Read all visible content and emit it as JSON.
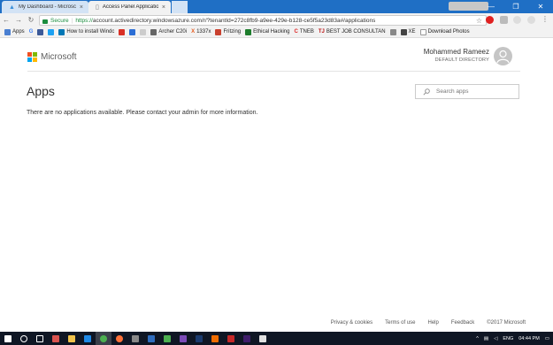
{
  "browser": {
    "tabs": [
      {
        "title": "My Dashboard - Microsc",
        "active": false
      },
      {
        "title": "Access Panel Applicatio",
        "active": true
      }
    ],
    "secure_label": "Secure",
    "url_proto": "https://",
    "url_rest": "account.activedirectory.windowsazure.com/r/?tenantId=272c8fb9-a9ee-429e-b128-ce5f5a23d83a#/applications",
    "bookmarks": [
      "Apps",
      "How to install Windc",
      "Archer C20i",
      "1337x",
      "Fritzing",
      "Ethical Hacking",
      "TNEB",
      "BEST JOB CONSULTAN",
      "XE",
      "Download Photos"
    ]
  },
  "header": {
    "brand": "Microsoft",
    "user_name": "Mohammed Rameez",
    "directory": "DEFAULT DIRECTORY"
  },
  "main": {
    "title": "Apps",
    "search_placeholder": "Search apps",
    "message": "There are no applications available. Please contact your admin for more information."
  },
  "footer": {
    "links": [
      "Privacy & cookies",
      "Terms of use",
      "Help",
      "Feedback"
    ],
    "copyright": "©2017 Microsoft"
  },
  "taskbar": {
    "lang": "ENG",
    "time": "04:44 PM"
  },
  "colors": {
    "ms_red": "#f25022",
    "ms_green": "#7fba00",
    "ms_blue": "#00a4ef",
    "ms_yellow": "#ffb900",
    "taskbar": "#0f1624",
    "tabstrip": "#1f6fc5"
  }
}
